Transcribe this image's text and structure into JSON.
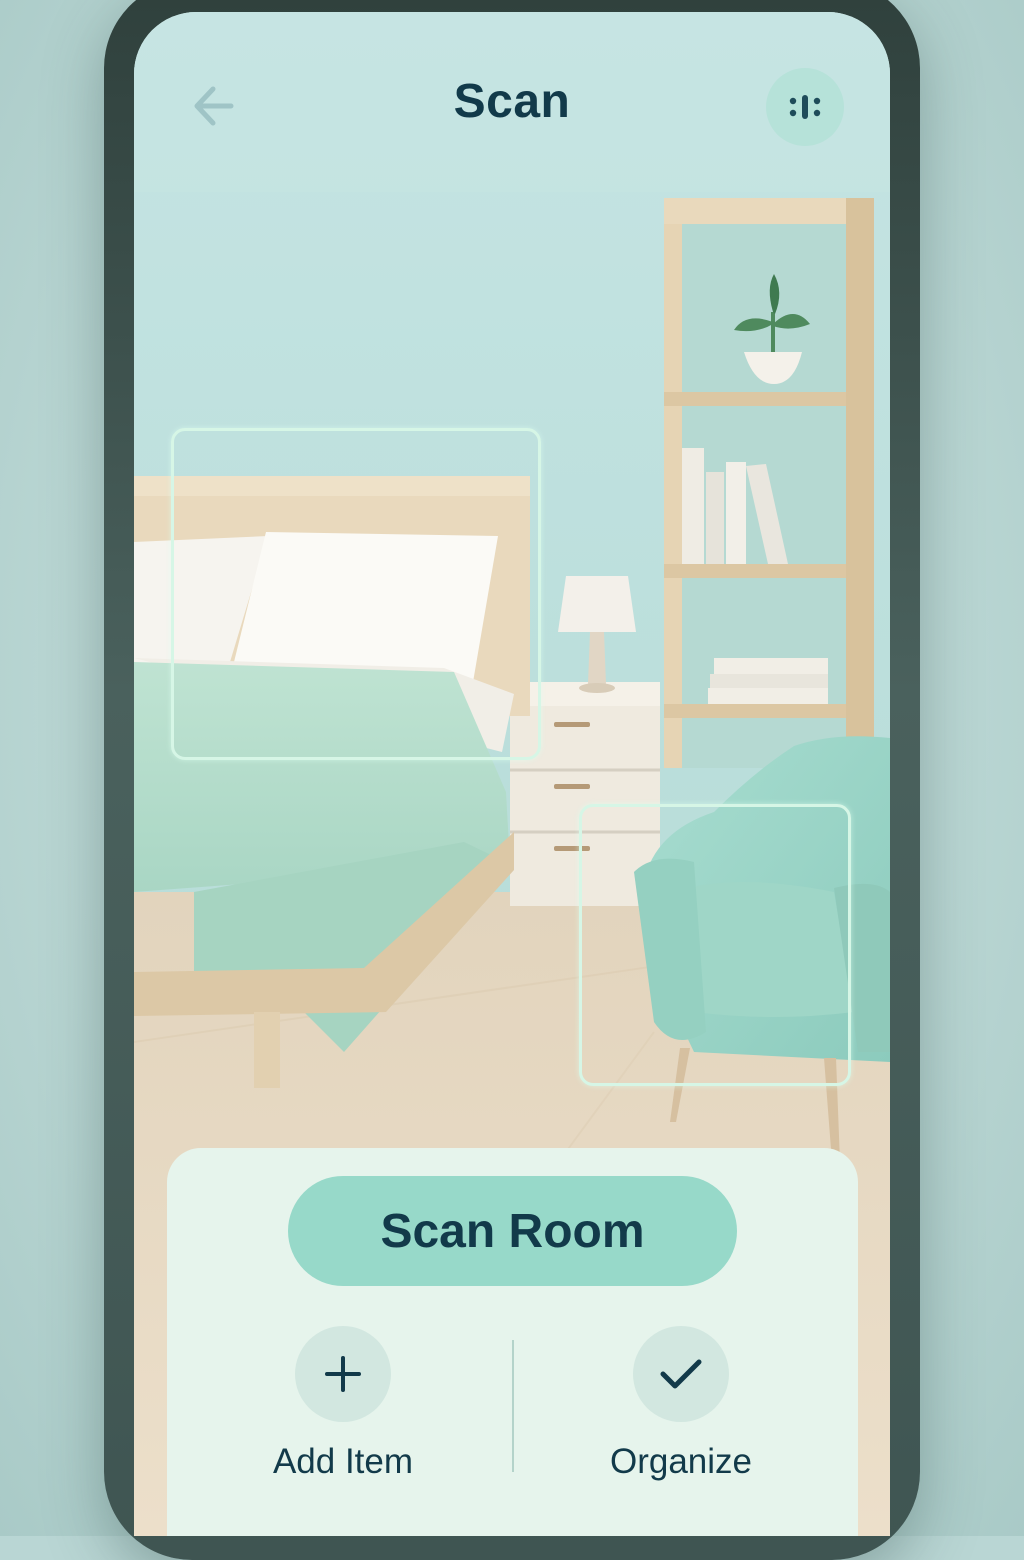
{
  "header": {
    "title": "Scan",
    "back_icon": "arrow-left-icon",
    "menu_icon": "scan-options-icon"
  },
  "detections": [
    {
      "name": "bed-detection-box"
    },
    {
      "name": "armchair-detection-box"
    }
  ],
  "actions": {
    "primary": {
      "label": "Scan Room"
    },
    "add_item": {
      "label": "Add Item",
      "icon": "plus-icon"
    },
    "organize": {
      "label": "Organize",
      "icon": "checkmark-icon"
    }
  },
  "colors": {
    "accent": "#97d9c9",
    "text_dark": "#123a4a",
    "panel": "#e6f4ec",
    "frame": "#3b504d"
  }
}
